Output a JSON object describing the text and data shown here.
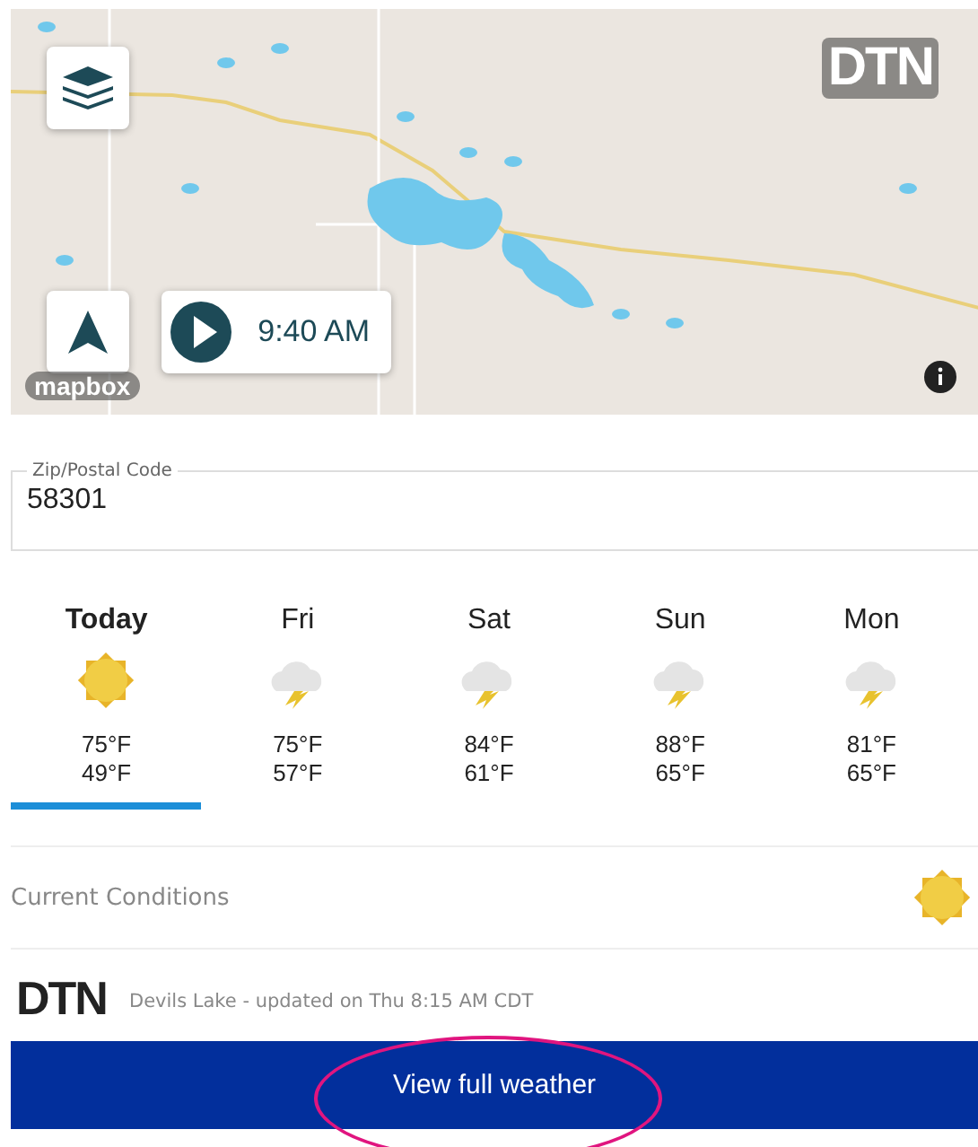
{
  "map": {
    "brand": "DTN",
    "attribution": "mapbox",
    "time": "9:40 AM",
    "playing": false
  },
  "location_field": {
    "label": "Zip/Postal Code",
    "value": "58301"
  },
  "forecast": [
    {
      "day": "Today",
      "kind": "sunny",
      "high": "75°F",
      "low": "49°F",
      "selected": true
    },
    {
      "day": "Fri",
      "kind": "storm",
      "high": "75°F",
      "low": "57°F",
      "selected": false
    },
    {
      "day": "Sat",
      "kind": "storm",
      "high": "84°F",
      "low": "61°F",
      "selected": false
    },
    {
      "day": "Sun",
      "kind": "storm",
      "high": "88°F",
      "low": "65°F",
      "selected": false
    },
    {
      "day": "Mon",
      "kind": "storm",
      "high": "81°F",
      "low": "65°F",
      "selected": false
    }
  ],
  "current_conditions": {
    "label": "Current Conditions",
    "kind": "sunny"
  },
  "footer": {
    "brand": "DTN",
    "updated": "Devils Lake - updated on Thu 8:15 AM CDT"
  },
  "button": {
    "label": "View full weather",
    "circled": true
  }
}
